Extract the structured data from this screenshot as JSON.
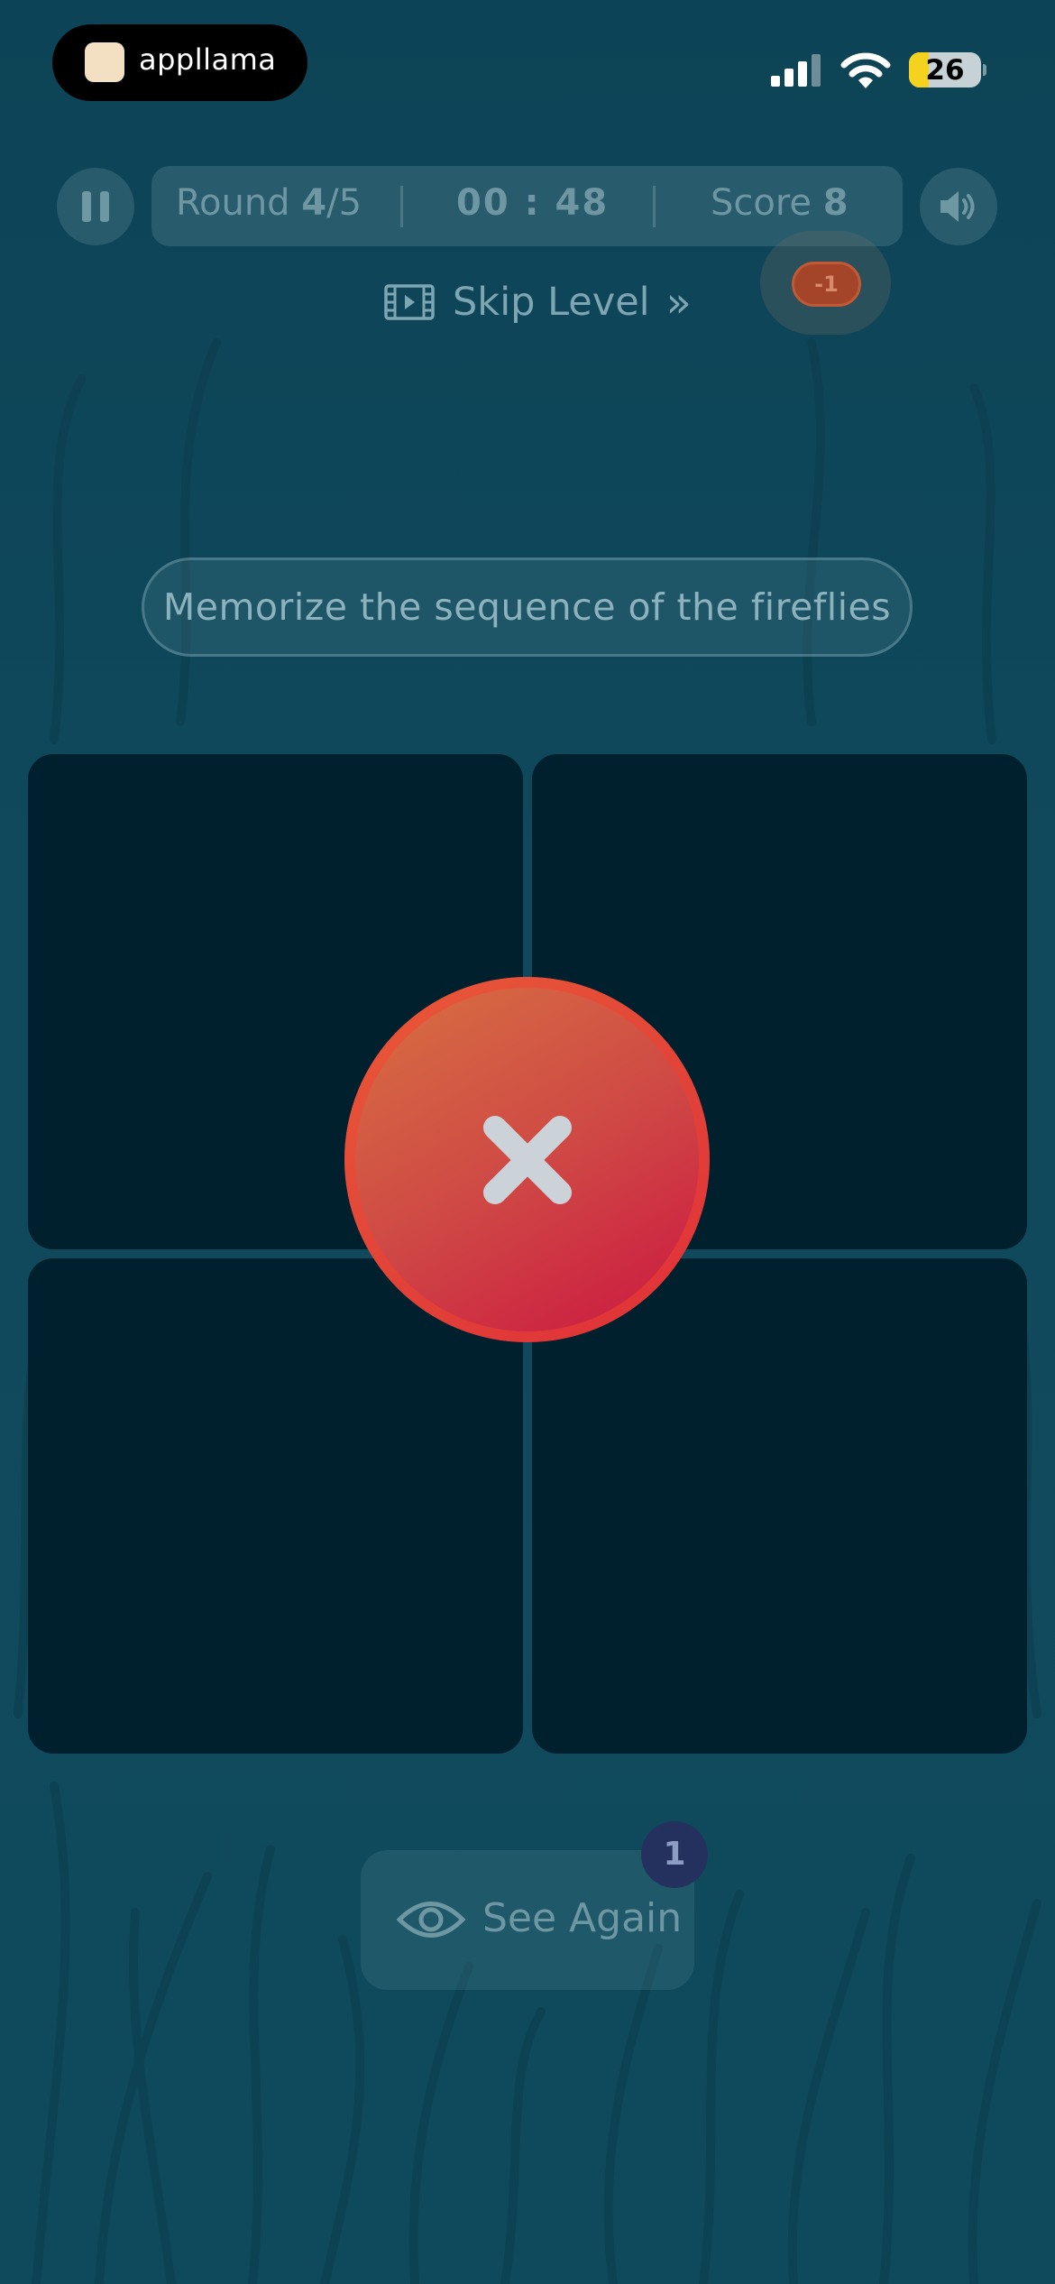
{
  "status_bar": {
    "app_name": "appllama",
    "battery_level": "26",
    "icons": [
      "signal-icon",
      "wifi-icon",
      "battery-icon"
    ]
  },
  "hud": {
    "round_label": "Round",
    "round_value": "4",
    "round_total": "/5",
    "timer": "00 : 48",
    "score_label": "Score",
    "score_value": "8"
  },
  "skip": {
    "label": "Skip Level",
    "chevron": "»"
  },
  "penalty": "-1",
  "instruction": "Memorize the sequence of the fireflies",
  "feedback": {
    "state": "wrong",
    "icon": "close-icon"
  },
  "see_again": {
    "label": "See Again",
    "badge_count": "1"
  },
  "colors": {
    "background": "#0f4a5d",
    "tile": "#01202d",
    "wrong": "#d63a3a",
    "penalty": "#a4452a",
    "badge": "#24315e"
  }
}
